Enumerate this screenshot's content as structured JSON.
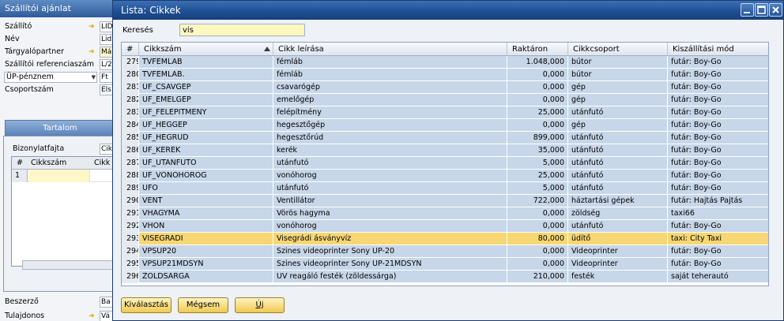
{
  "background_window": {
    "title": "Szállítói ajánlat",
    "fields": [
      {
        "label": "Szállító",
        "value": "LID",
        "arrow": true,
        "yellow": false
      },
      {
        "label": "Név",
        "value": "Lid",
        "arrow": false,
        "yellow": false
      },
      {
        "label": "Tárgyalópartner",
        "value": "Má",
        "arrow": true,
        "yellow": true
      },
      {
        "label": "Szállítói referenciaszám",
        "value": "L/2",
        "arrow": false,
        "yellow": false
      },
      {
        "label": "ÜP-pénznem",
        "value": "Ft",
        "arrow": false,
        "yellow": false
      },
      {
        "label": "Csoportszám",
        "value": "Els",
        "arrow": false,
        "yellow": false
      }
    ],
    "tab_label": "Tartalom",
    "doc_type_label": "Bizonylatfajta",
    "doc_type_value": "Cik",
    "mini_grid": {
      "col_num": "#",
      "col_code": "Cikkszám",
      "col_next": "Cikk",
      "row_num": "1"
    },
    "buyer_label": "Beszerző",
    "buyer_value": "Ba",
    "owner_label": "Tulajdonos",
    "owner_value": "Vá"
  },
  "modal": {
    "title": "Lista: Cikkek",
    "search_label": "Keresés",
    "search_value": "vis",
    "columns": [
      "#",
      "Cikkszám",
      "Cikk leírása",
      "Raktáron",
      "Cikkcsoport",
      "Kiszállítási mód"
    ],
    "rows": [
      {
        "num": "279",
        "code": "TVFEMLAB",
        "desc": "fémláb",
        "stock": "1.048,000",
        "group": "bútor",
        "ship": "futár: Boy-Go"
      },
      {
        "num": "280",
        "code": "TVFEMLAB.",
        "desc": "fémláb",
        "stock": "0,000",
        "group": "bútor",
        "ship": "futár: Boy-Go"
      },
      {
        "num": "281",
        "code": "UF_CSAVGEP",
        "desc": "csavarógép",
        "stock": "0,000",
        "group": "gép",
        "ship": "futár: Boy-Go"
      },
      {
        "num": "282",
        "code": "UF_EMELGEP",
        "desc": "emelőgép",
        "stock": "0,000",
        "group": "gép",
        "ship": "futár: Boy-Go"
      },
      {
        "num": "283",
        "code": "UF_FELEPITMENY",
        "desc": "felépítmény",
        "stock": "25,000",
        "group": "utánfutó",
        "ship": "futár: Boy-Go"
      },
      {
        "num": "284",
        "code": "UF_HEGGEP",
        "desc": "hegesztőgép",
        "stock": "0,000",
        "group": "gép",
        "ship": "futár: Boy-Go"
      },
      {
        "num": "285",
        "code": "UF_HEGRUD",
        "desc": "hegesztőrúd",
        "stock": "899,000",
        "group": "utánfutó",
        "ship": "futár: Boy-Go"
      },
      {
        "num": "286",
        "code": "UF_KEREK",
        "desc": "kerék",
        "stock": "35,000",
        "group": "utánfutó",
        "ship": "futár: Boy-Go"
      },
      {
        "num": "287",
        "code": "UF_UTANFUTO",
        "desc": "utánfutó",
        "stock": "5,000",
        "group": "utánfutó",
        "ship": "futár: Boy-Go"
      },
      {
        "num": "288",
        "code": "UF_VONOHOROG",
        "desc": "vonóhorog",
        "stock": "25,000",
        "group": "utánfutó",
        "ship": "futár: Boy-Go"
      },
      {
        "num": "289",
        "code": "UFO",
        "desc": "utánfutó",
        "stock": "5,000",
        "group": "utánfutó",
        "ship": "futár: Boy-Go"
      },
      {
        "num": "290",
        "code": "VENT",
        "desc": "Ventillátor",
        "stock": "722,000",
        "group": "háztartási gépek",
        "ship": "futár: Hajtás Pajtás"
      },
      {
        "num": "291",
        "code": "VHAGYMA",
        "desc": "Vörös hagyma",
        "stock": "0,000",
        "group": "zöldség",
        "ship": "taxi66"
      },
      {
        "num": "292",
        "code": "VHON",
        "desc": "vonóhorog",
        "stock": "0,000",
        "group": "utánfutó",
        "ship": "futár: Boy-Go"
      },
      {
        "num": "293",
        "code": "VISEGRADI",
        "desc": "Visegrádi ásványvíz",
        "stock": "80,000",
        "group": "üdítő",
        "ship": "taxi: City Taxi"
      },
      {
        "num": "294",
        "code": "VPSUP20",
        "desc": "Szines videoprinter Sony UP-20",
        "stock": "0,000",
        "group": "Videoprinter",
        "ship": "futár: Boy-Go"
      },
      {
        "num": "295",
        "code": "VPSUP21MDSYN",
        "desc": "Szines videoprinter Sony UP-21MDSYN",
        "stock": "0,000",
        "group": "Videoprinter",
        "ship": "futár: Boy-Go"
      },
      {
        "num": "296",
        "code": "ZOLDSARGA",
        "desc": "UV reagáló festék (zöldessárga)",
        "stock": "210,000",
        "group": "festék",
        "ship": "saját teherautó"
      }
    ],
    "selected_row": "293",
    "buttons": {
      "select": "Kiválasztás",
      "cancel": "Mégsem",
      "new": "Új"
    }
  },
  "colors": {
    "row_bg": "#c7d6e8",
    "selected_row": "#f7d774",
    "title_bar": "#1f4f93",
    "button": "#f0c950"
  }
}
